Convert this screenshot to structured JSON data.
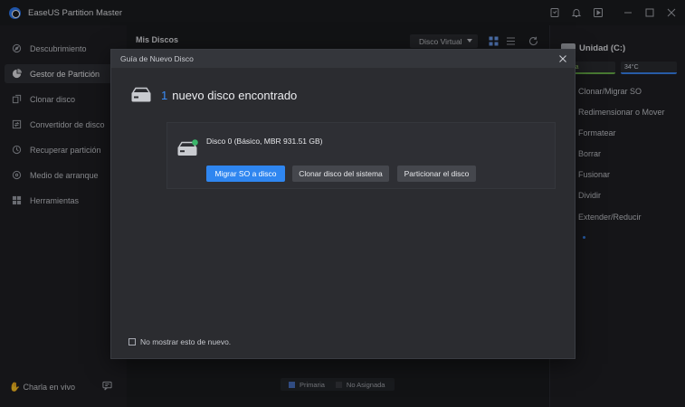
{
  "app": {
    "title": "EaseUS Partition Master"
  },
  "sidebar": {
    "items": [
      {
        "label": "Descubrimiento",
        "icon": "compass-icon"
      },
      {
        "label": "Gestor de Partición",
        "icon": "pie-chart-icon",
        "active": true
      },
      {
        "label": "Clonar disco",
        "icon": "clone-icon"
      },
      {
        "label": "Convertidor de disco",
        "icon": "convert-icon"
      },
      {
        "label": "Recuperar partición",
        "icon": "recover-icon"
      },
      {
        "label": "Medio de arranque",
        "icon": "boot-media-icon"
      },
      {
        "label": "Herramientas",
        "icon": "tools-icon"
      }
    ],
    "chat_label": "Charla en vivo"
  },
  "main": {
    "title": "Mis Discos",
    "virtual_disk_label": "Disco Virtual",
    "legend": {
      "primary_label": "Primaria",
      "unallocated_label": "No Asignada",
      "primary_color": "#4a73c5",
      "unallocated_color": "#3a3c42"
    }
  },
  "right_panel": {
    "unit_title": "Unidad (C:)",
    "health_label": "uena",
    "temperature_label": "34°C",
    "actions": [
      "Clonar/Migrar SO",
      "Redimensionar o Mover",
      "Formatear",
      "Borrar",
      "Fusionar",
      "Dividir",
      "Extender/Reducir"
    ]
  },
  "dialog": {
    "title": "Guía de Nuevo Disco",
    "found_count": "1",
    "found_text": "nuevo disco encontrado",
    "disk_name": "Disco 0 (Básico, MBR 931.51 GB)",
    "buttons": {
      "migrate": "Migrar SO a disco",
      "clone": "Clonar disco del sistema",
      "partition": "Particionar el disco"
    },
    "dont_show_label": "No mostrar esto de nuevo.",
    "dont_show_checked": false,
    "accent_color": "#2f86f0"
  }
}
